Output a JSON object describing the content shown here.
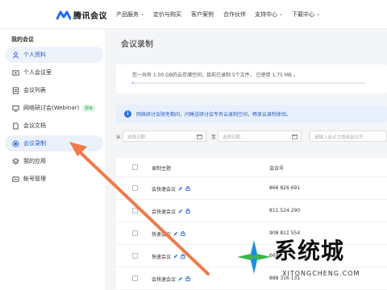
{
  "brand": {
    "name": "腾讯会议"
  },
  "nav": {
    "items": [
      {
        "label": "产品服务",
        "has_dropdown": true
      },
      {
        "label": "定价与购买",
        "has_dropdown": false
      },
      {
        "label": "客户案例",
        "has_dropdown": false
      },
      {
        "label": "合作伙伴",
        "has_dropdown": false
      },
      {
        "label": "支持中心",
        "has_dropdown": true
      },
      {
        "label": "下载中心",
        "has_dropdown": true
      }
    ]
  },
  "sidebar": {
    "title": "我的会议",
    "items": [
      {
        "label": "个人资料",
        "icon": "user-icon",
        "active": false,
        "highlight": true
      },
      {
        "label": "个人会议室",
        "icon": "meeting-room-icon",
        "active": false
      },
      {
        "label": "会议列表",
        "icon": "list-icon",
        "active": false
      },
      {
        "label": "网络研讨会(Webinar)",
        "icon": "monitor-icon",
        "active": false,
        "badge": "限免"
      },
      {
        "label": "会议文档",
        "icon": "document-icon",
        "active": false
      },
      {
        "label": "会议录制",
        "icon": "record-icon",
        "active": true
      },
      {
        "label": "我的应用",
        "icon": "apps-icon",
        "active": false
      },
      {
        "label": "帐号管理",
        "icon": "account-icon",
        "active": false
      }
    ]
  },
  "main": {
    "title": "会议录制",
    "quota": {
      "text": "您一共有 1.00 GB的云存储空间，目前已录制 5个文件， 已使用 1.75 MB 。",
      "used_fraction": 0.0017
    },
    "notice": {
      "text": "网络研讨会限免期间，问睡送研讨会专有云录制空间，畅享云录制体验。"
    },
    "filters": {
      "from_label": "从",
      "to_label": "至",
      "start_placeholder": "选择日期",
      "end_placeholder": "选择日期",
      "search_placeholder": "请输入会议主题或会议号"
    },
    "table": {
      "headers": {
        "subject": "录制主题",
        "meeting_id": "会议号"
      },
      "rows": [
        {
          "subject": "会快速会议",
          "meeting_id": "866 826 691"
        },
        {
          "subject": "会快速会议",
          "meeting_id": "811 524 290"
        },
        {
          "subject": "快速会议",
          "meeting_id": "908 811 554"
        },
        {
          "subject": "快速会议",
          "meeting_id": "669"
        },
        {
          "subject": "会快速会议",
          "meeting_id": "888 316 131"
        }
      ]
    }
  },
  "watermark": {
    "main": "系统城",
    "sub": "XITONGCHENG.COM"
  },
  "colors": {
    "accent": "#1f5bd6",
    "arrow": "#f07a4a",
    "active_bg": "#ebf1fb"
  }
}
